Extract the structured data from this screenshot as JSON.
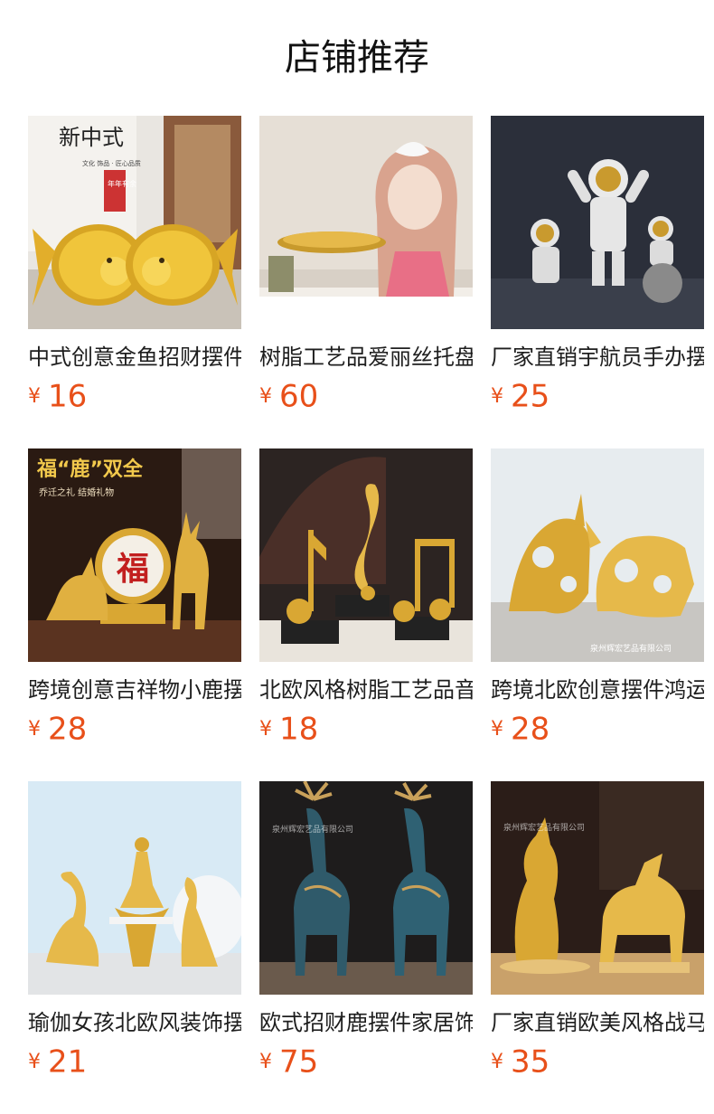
{
  "section": {
    "title": "店铺推荐"
  },
  "currency": "¥",
  "products": [
    {
      "name": "中式创意金鱼招财摆件",
      "price": "16",
      "image": "golden-fish-figurine",
      "image_text": {
        "top": "新中式",
        "side": "文化 饰品 · 匠心品质",
        "seal": "年年有余"
      }
    },
    {
      "name": "树脂工艺品爱丽丝托盘",
      "price": "60",
      "image": "alice-girl-tray-figurine"
    },
    {
      "name": "厂家直销宇航员手办摆件",
      "price": "25",
      "image": "astronaut-figurines"
    },
    {
      "name": "跨境创意吉祥物小鹿摆件",
      "price": "28",
      "image": "golden-deer-fu-figurine",
      "image_text": {
        "banner": "福“鹿”双全",
        "sub": "乔迁之礼 结婚礼物",
        "fu": "福"
      }
    },
    {
      "name": "北欧风格树脂工艺品音符",
      "price": "18",
      "image": "music-note-figurines"
    },
    {
      "name": "跨境北欧创意摆件鸿运牛",
      "price": "28",
      "image": "golden-bull-figurines",
      "image_text": {
        "watermark": "泉州辉宏艺品有限公司"
      }
    },
    {
      "name": "瑜伽女孩北欧风装饰摆件",
      "price": "21",
      "image": "yoga-girl-figurines"
    },
    {
      "name": "欧式招财鹿摆件家居饰品",
      "price": "75",
      "image": "blue-deer-figurines",
      "image_text": {
        "watermark": "泉州辉宏艺品有限公司"
      }
    },
    {
      "name": "厂家直销欧美风格战马摆件",
      "price": "35",
      "image": "golden-horse-figurines",
      "image_text": {
        "watermark": "泉州辉宏艺品有限公司"
      }
    }
  ]
}
